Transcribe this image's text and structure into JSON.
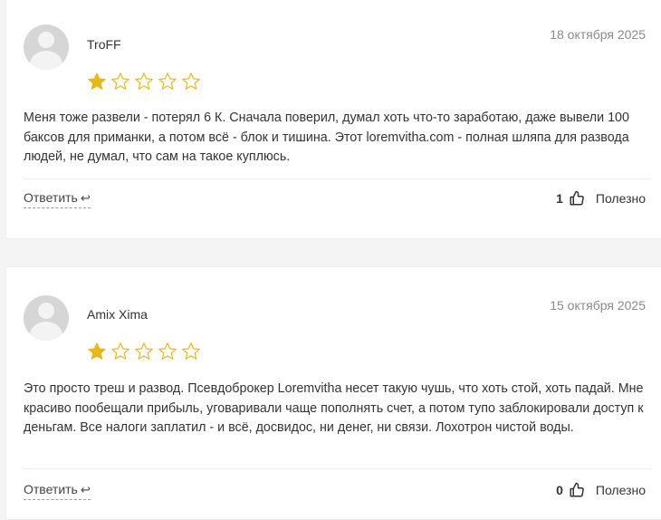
{
  "reviews": [
    {
      "author": "TroFF",
      "date": "18 октября 2025",
      "rating": 1,
      "max_rating": 5,
      "text": "Меня тоже развели - потерял 6 К. Сначала поверил, думал хоть что-то заработаю, даже вывели 100 баксов для приманки, а потом всё - блок и тишина. Этот loremvitha.com - полная шляпа для развода людей, не думал, что сам на такое куплюсь.",
      "reply_label": "Ответить",
      "useful_count": "1",
      "useful_label": "Полезно"
    },
    {
      "author": "Amix Xima",
      "date": "15 октября 2025",
      "rating": 1,
      "max_rating": 5,
      "text": "Это просто треш и развод. Псевдоброкер Loremvitha несет такую чушь, что хоть стой, хоть падай. Мне красиво пообещали прибыль, уговаривали чаще пополнять счет, а потом тупо заблокировали доступ к деньгам. Все налоги заплатил - и всё, досвидос, ни денег, ни связи. Лохотрон чистой воды.",
      "reply_label": "Ответить",
      "useful_count": "0",
      "useful_label": "Полезно"
    }
  ],
  "colors": {
    "star_filled": "#e8b916",
    "star_empty_stroke": "#e8b916",
    "date": "#8a8a8a"
  },
  "icons": {
    "reply": "reply-arrow-icon",
    "useful": "thumbs-up-icon",
    "star": "star-icon",
    "avatar": "user-avatar-placeholder"
  }
}
